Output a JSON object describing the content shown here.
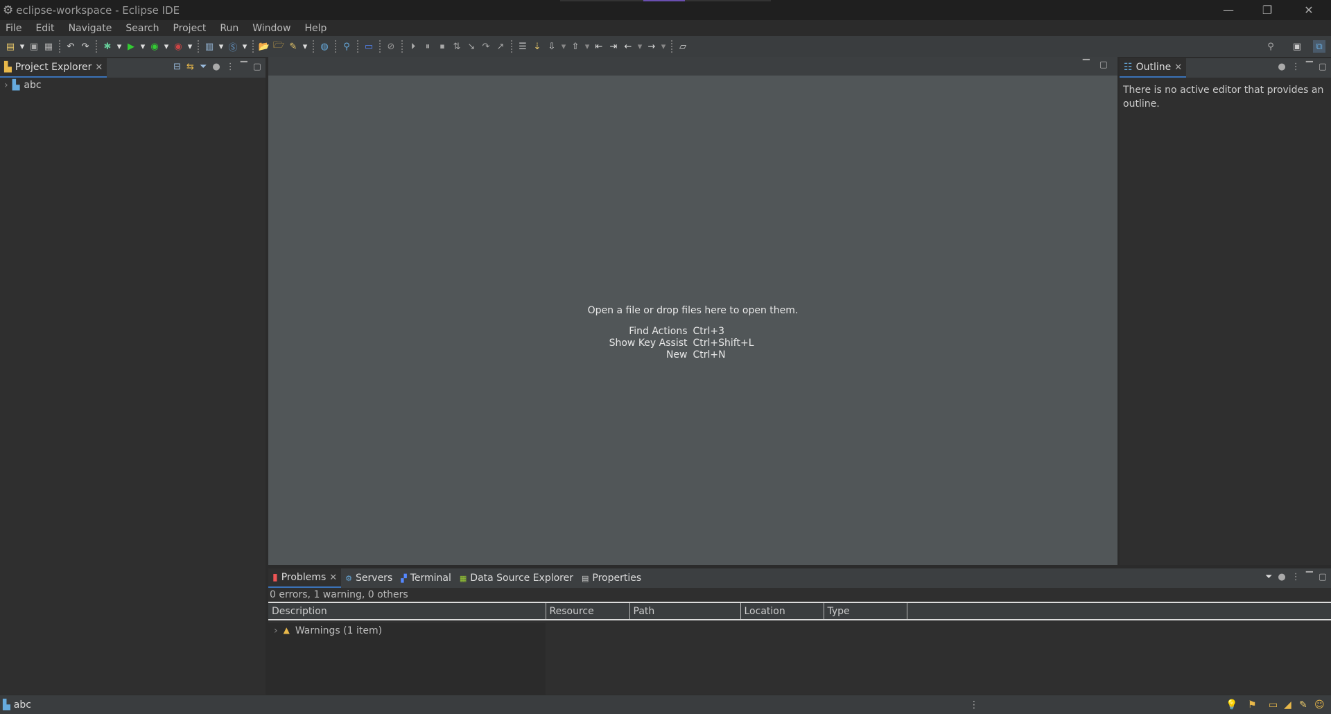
{
  "window": {
    "title": "eclipse-workspace - Eclipse IDE",
    "minimize": "—",
    "restore": "❐",
    "close": "✕"
  },
  "menu": [
    "File",
    "Edit",
    "Navigate",
    "Search",
    "Project",
    "Run",
    "Window",
    "Help"
  ],
  "project_explorer": {
    "tab": "Project Explorer",
    "items": [
      {
        "label": "abc"
      }
    ]
  },
  "editor": {
    "message": "Open a file or drop files here to open them.",
    "shortcuts": [
      {
        "label": "Find Actions",
        "key": "Ctrl+3"
      },
      {
        "label": "Show Key Assist",
        "key": "Ctrl+Shift+L"
      },
      {
        "label": "New",
        "key": "Ctrl+N"
      }
    ]
  },
  "outline": {
    "tab": "Outline",
    "message": "There is no active editor that provides an outline."
  },
  "bottom": {
    "tabs": [
      "Problems",
      "Servers",
      "Terminal",
      "Data Source Explorer",
      "Properties"
    ],
    "summary": "0 errors, 1 warning, 0 others",
    "columns": [
      "Description",
      "Resource",
      "Path",
      "Location",
      "Type"
    ],
    "rows": [
      {
        "label": "Warnings (1 item)"
      }
    ]
  },
  "status": {
    "selection": "abc"
  }
}
